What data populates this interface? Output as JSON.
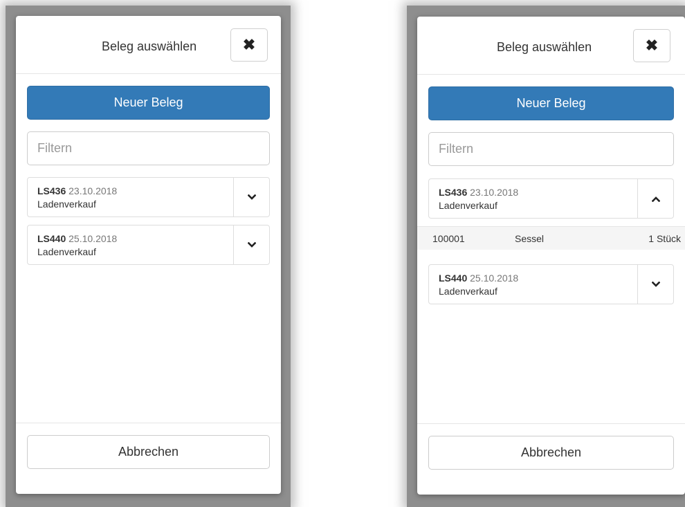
{
  "left": {
    "title": "Beleg auswählen",
    "close_icon": "close-x-icon",
    "new_button": "Neuer Beleg",
    "filter_placeholder": "Filtern",
    "documents": [
      {
        "number": "LS436",
        "date": "23.10.2018",
        "type": "Ladenverkauf",
        "expanded": false
      },
      {
        "number": "LS440",
        "date": "25.10.2018",
        "type": "Ladenverkauf",
        "expanded": false
      }
    ],
    "cancel_button": "Abbrechen"
  },
  "right": {
    "title": "Beleg auswählen",
    "close_icon": "close-x-icon",
    "new_button": "Neuer Beleg",
    "filter_placeholder": "Filtern",
    "documents": [
      {
        "number": "LS436",
        "date": "23.10.2018",
        "type": "Ladenverkauf",
        "expanded": true,
        "lines": [
          {
            "article": "100001",
            "name": "Sessel",
            "quantity": "1 Stück"
          }
        ]
      },
      {
        "number": "LS440",
        "date": "25.10.2018",
        "type": "Ladenverkauf",
        "expanded": false
      }
    ],
    "cancel_button": "Abbrechen"
  },
  "colors": {
    "primary": "#337ab7",
    "border": "#dddddd",
    "backdrop": "#8e8e8e"
  }
}
